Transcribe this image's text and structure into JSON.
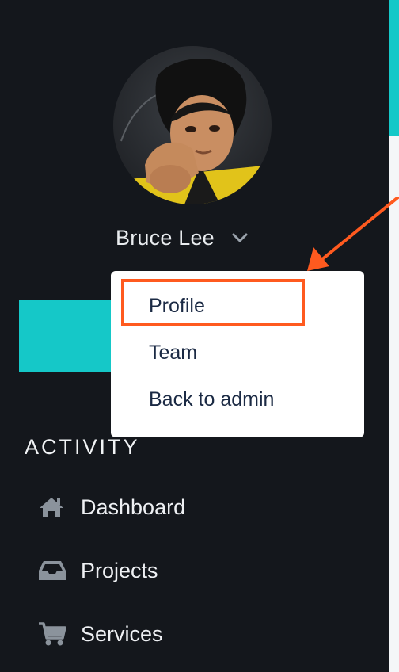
{
  "user": {
    "name": "Bruce Lee",
    "avatar_icon": "avatar-photo"
  },
  "user_menu": {
    "items": [
      {
        "label": "Profile",
        "highlighted": true
      },
      {
        "label": "Team"
      },
      {
        "label": "Back to admin"
      }
    ]
  },
  "activity": {
    "title": "ACTIVITY",
    "items": [
      {
        "label": "Dashboard",
        "icon": "home-icon"
      },
      {
        "label": "Projects",
        "icon": "inbox-icon"
      },
      {
        "label": "Services",
        "icon": "cart-icon"
      }
    ]
  },
  "colors": {
    "sidebar_bg": "#14171c",
    "accent": "#15c8c8",
    "annotation": "#ff5a1f",
    "menu_text": "#1b2a44"
  }
}
